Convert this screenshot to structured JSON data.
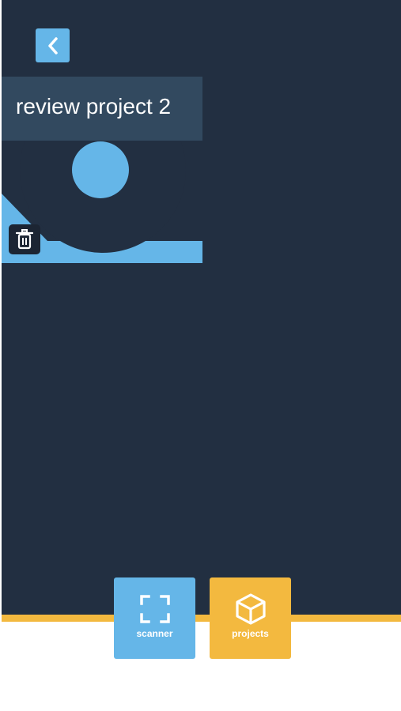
{
  "header": {
    "back_icon": "chevron-left-icon"
  },
  "projects": [
    {
      "title": "review project 2",
      "delete_icon": "trash-icon"
    }
  ],
  "bottom_nav": {
    "scanner": {
      "label": "scanner",
      "icon": "scan-frame-icon"
    },
    "projects": {
      "label": "projects",
      "icon": "cube-icon"
    }
  },
  "colors": {
    "background": "#222f41",
    "accent_blue": "#65b6e8",
    "accent_yellow": "#f3b93f",
    "title_bar": "#375067"
  }
}
